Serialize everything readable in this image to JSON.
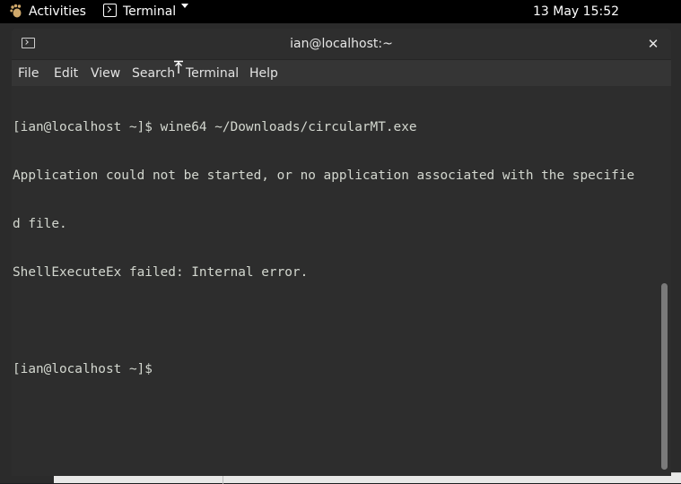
{
  "topbar": {
    "activities_label": "Activities",
    "app_label": "Terminal",
    "clock": "13 May  15:52"
  },
  "window": {
    "title": "ian@localhost:~",
    "close_glyph": "✕"
  },
  "menubar": {
    "items": [
      "File",
      "Edit",
      "View",
      "Search",
      "Terminal",
      "Help"
    ]
  },
  "terminal": {
    "lines": [
      "[ian@localhost ~]$ wine64 ~/Downloads/circularMT.exe",
      "Application could not be started, or no application associated with the specifie",
      "d file.",
      "ShellExecuteEx failed: Internal error.",
      "",
      "[ian@localhost ~]$ "
    ]
  },
  "colors": {
    "topbar_bg": "#000000",
    "window_bg": "#2d2d2d",
    "terminal_fg": "#d3d7cf",
    "menu_fg": "#e3e3e3"
  },
  "icons": {
    "activities": "gnome-foot-icon",
    "app": "terminal-icon",
    "window": "terminal-icon",
    "cursor": "text-cursor-icon"
  }
}
